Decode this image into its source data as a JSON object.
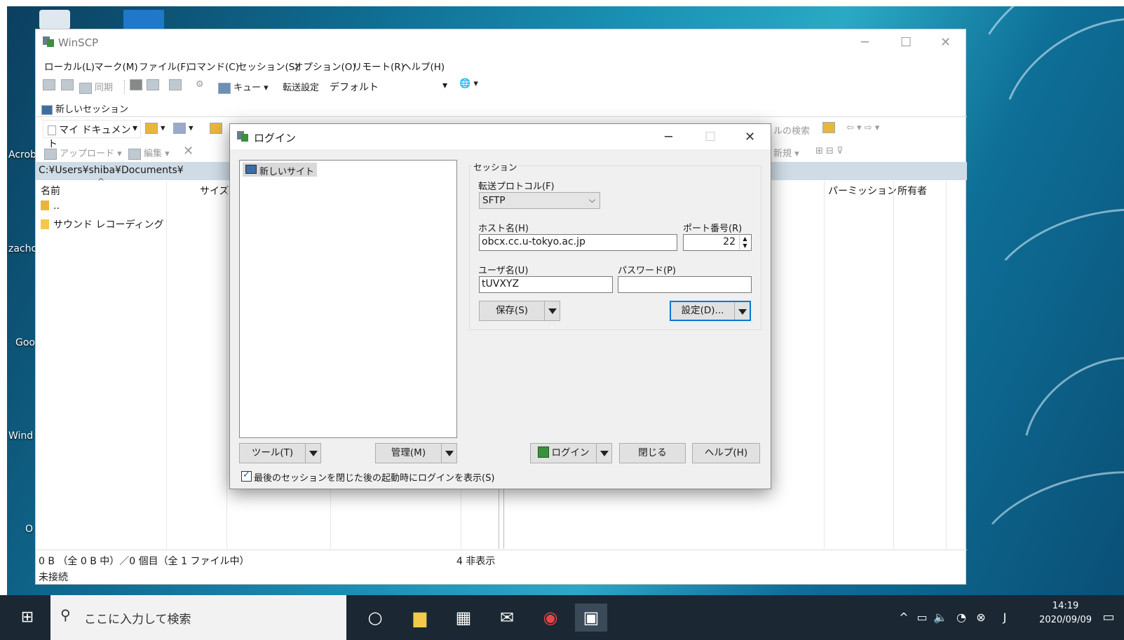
{
  "desktop": {
    "icon_labels": [
      "Acrob",
      "zacho",
      "Goo",
      "Wind",
      "O"
    ]
  },
  "app": {
    "title": "WinSCP"
  },
  "menu": [
    "ローカル(L)",
    "マーク(M)",
    "ファイル(F)",
    "コマンド(C)",
    "セッション(S)",
    "オプション(O)",
    "リモート(R)",
    "ヘルプ(H)"
  ],
  "toolbar": {
    "sync": "同期",
    "queue": "キュー",
    "transfer_label": "転送設定",
    "transfer_value": "デフォルト"
  },
  "session_tab": {
    "label": "新しいセッション"
  },
  "local_toolbar": {
    "location": "マイ ドキュメント",
    "upload": "アップロード",
    "edit": "編集"
  },
  "remote_toolbar": {
    "find": "ルの検索",
    "new": "新規"
  },
  "local_panel": {
    "path": "C:¥Users¥shiba¥Documents¥",
    "col_name": "名前",
    "col_size": "サイズ",
    "items": [
      "..",
      "サウンド レコーディング"
    ]
  },
  "remote_panel": {
    "col_perm": "パーミッション",
    "col_owner": "所有者"
  },
  "status": {
    "left": "0 B （全 0 B 中）／0 個目（全 1 ファイル中）",
    "hidden": "4 非表示",
    "connection": "未接続"
  },
  "dialog": {
    "title": "ログイン",
    "site": "新しいサイト",
    "group": "セッション",
    "protocol_label": "転送プロトコル(F)",
    "protocol_value": "SFTP",
    "host_label": "ホスト名(H)",
    "host_value": "obcx.cc.u-tokyo.ac.jp",
    "port_label": "ポート番号(R)",
    "port_value": "22",
    "user_label": "ユーザ名(U)",
    "user_value": "tUVXYZ",
    "pass_label": "パスワード(P)",
    "save": "保存(S)",
    "settings": "設定(D)...",
    "tools": "ツール(T)",
    "manage": "管理(M)",
    "login": "ログイン",
    "close": "閉じる",
    "help": "ヘルプ(H)",
    "checkbox_label": "最後のセッションを閉じた後の起動時にログインを表示(S)",
    "checkbox_checked": true
  },
  "taskbar": {
    "search_placeholder": "ここに入力して検索",
    "time": "14:19",
    "date": "2020/09/09"
  }
}
